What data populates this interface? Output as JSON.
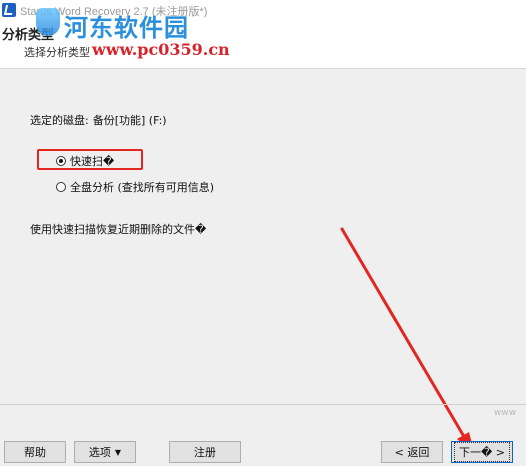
{
  "window": {
    "title": "Starus Word Recovery 2.7 (未注册版*)"
  },
  "header": {
    "title": "分析类型",
    "subtitle": "选择分析类型"
  },
  "watermark": {
    "main_text": "河东软件园",
    "url_text": "www.pc0359.cn"
  },
  "content": {
    "disk_label": "选定的磁盘:",
    "disk_value": "备份[功能] (F:)",
    "options": [
      {
        "label": "快速扫�",
        "checked": true
      },
      {
        "label": "全盘分析 (查找所有可用信息)",
        "checked": false
      }
    ],
    "description": "使用快速扫描恢复近期删除的文件�"
  },
  "footer": {
    "watermark_text": "www",
    "buttons": {
      "help": "帮助",
      "options": "选项",
      "register": "注册",
      "back": "< 返回",
      "next": "下一� >"
    }
  },
  "colors": {
    "highlight": "#e3261f",
    "watermark_blue": "#2b8fdc",
    "watermark_red": "#d8232a"
  },
  "icons": {
    "app": "app-logo-icon",
    "options_caret": "caret-down-icon"
  }
}
